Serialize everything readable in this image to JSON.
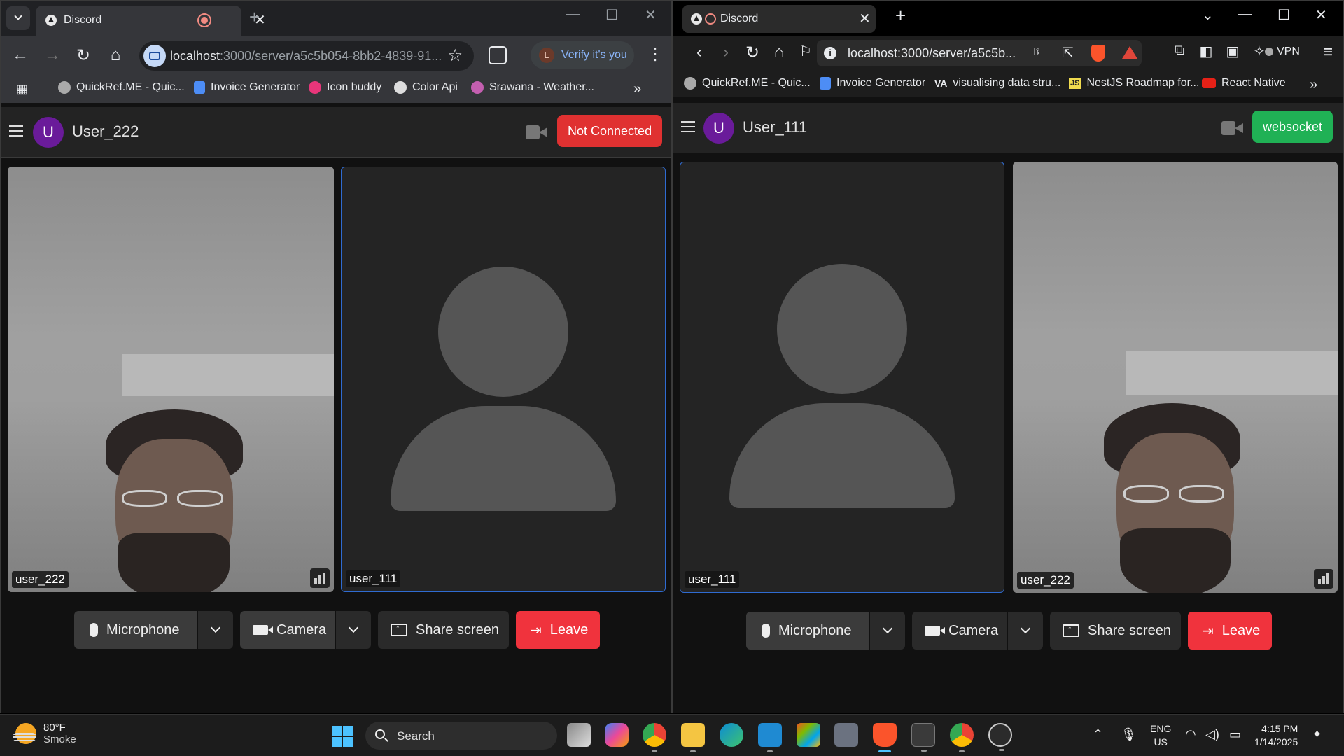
{
  "left_browser": {
    "tab_title": "Discord",
    "url_host": "localhost",
    "url_rest": ":3000/server/a5c5b054-8bb2-4839-91...",
    "verify_label": "Verify it's you",
    "profile_initial": "L",
    "bookmarks": [
      "QuickRef.ME - Quic...",
      "Invoice Generator",
      "Icon buddy",
      "Color Api",
      "Srawana - Weather..."
    ]
  },
  "left_app": {
    "avatar_initial": "U",
    "username": "User_222",
    "status_label": "Not Connected",
    "status_color": "#e03131",
    "tiles": [
      "user_222",
      "user_111"
    ],
    "controls": {
      "microphone": "Microphone",
      "camera": "Camera",
      "share": "Share screen",
      "leave": "Leave"
    }
  },
  "right_browser": {
    "tab_title": "Discord",
    "url": "localhost:3000/server/a5c5b...",
    "vpn_label": "VPN",
    "bookmarks": [
      "QuickRef.ME - Quic...",
      "Invoice Generator",
      "visualising data stru...",
      "NestJS Roadmap for...",
      "React Native"
    ],
    "js_badge": "JS",
    "va_badge": "VA"
  },
  "right_app": {
    "avatar_initial": "U",
    "username": "User_111",
    "status_label": "websocket",
    "status_color": "#20b155",
    "tiles": [
      "user_111",
      "user_222"
    ],
    "controls": {
      "microphone": "Microphone",
      "camera": "Camera",
      "share": "Share screen",
      "leave": "Leave"
    }
  },
  "taskbar": {
    "temperature": "80°F",
    "weather": "Smoke",
    "search_placeholder": "Search",
    "lang1": "ENG",
    "lang2": "US",
    "time": "4:15 PM",
    "date": "1/14/2025"
  }
}
